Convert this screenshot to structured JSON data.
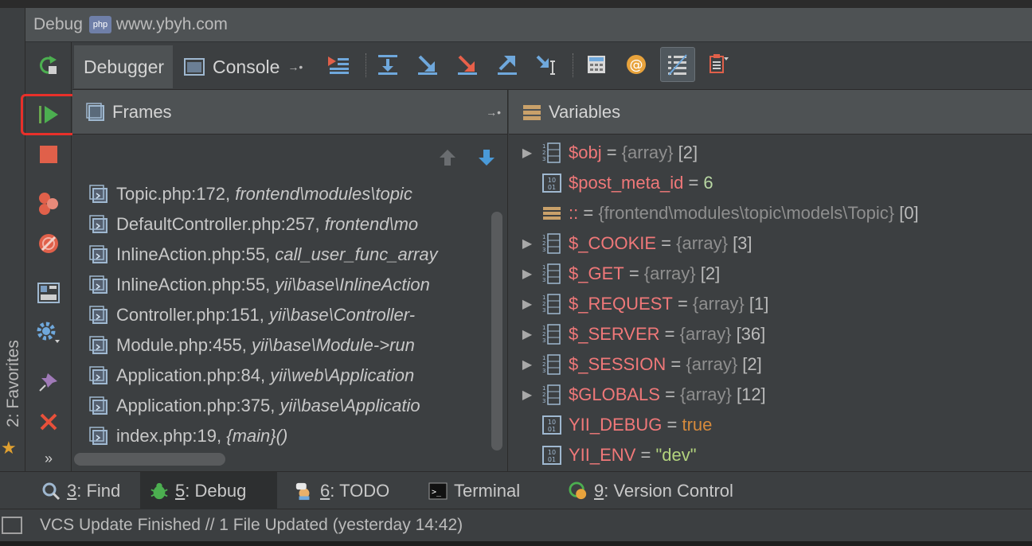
{
  "window": {
    "title_prefix": "Debug",
    "php_badge": "php",
    "title": "www.ybyh.com"
  },
  "sidebar": {
    "favorites_label": "2: Favorites"
  },
  "tabs": {
    "debugger": "Debugger",
    "console": "Console"
  },
  "frames": {
    "title": "Frames",
    "rows": [
      {
        "file": "Topic.php:172, ",
        "context": "frontend\\modules\\topic"
      },
      {
        "file": "DefaultController.php:257, ",
        "context": "frontend\\mo"
      },
      {
        "file": "InlineAction.php:55, ",
        "context": "call_user_func_array"
      },
      {
        "file": "InlineAction.php:55, ",
        "context": "yii\\base\\InlineAction"
      },
      {
        "file": "Controller.php:151, ",
        "context": "yii\\base\\Controller-"
      },
      {
        "file": "Module.php:455, ",
        "context": "yii\\base\\Module->run"
      },
      {
        "file": "Application.php:84, ",
        "context": "yii\\web\\Application"
      },
      {
        "file": "Application.php:375, ",
        "context": "yii\\base\\Applicatio"
      },
      {
        "file": "index.php:19, ",
        "context": "{main}()"
      }
    ]
  },
  "variables": {
    "title": "Variables",
    "rows": [
      {
        "name": "$obj",
        "eq": " = ",
        "type": "{array}",
        "count": " [2]"
      },
      {
        "name": "$post_meta_id",
        "eq": " = ",
        "value": "6"
      },
      {
        "name": "::",
        "eq": " = ",
        "type": "{frontend\\modules\\topic\\models\\Topic}",
        "count": " [0]"
      },
      {
        "name": "$_COOKIE",
        "eq": " = ",
        "type": "{array}",
        "count": " [3]"
      },
      {
        "name": "$_GET",
        "eq": " = ",
        "type": "{array}",
        "count": " [2]"
      },
      {
        "name": "$_REQUEST",
        "eq": " = ",
        "type": "{array}",
        "count": " [1]"
      },
      {
        "name": "$_SERVER",
        "eq": " = ",
        "type": "{array}",
        "count": " [36]"
      },
      {
        "name": "$_SESSION",
        "eq": " = ",
        "type": "{array}",
        "count": " [2]"
      },
      {
        "name": "$GLOBALS",
        "eq": " = ",
        "type": "{array}",
        "count": " [12]"
      },
      {
        "name": "YII_DEBUG",
        "eq": " = ",
        "value": "true"
      },
      {
        "name": "YII_ENV",
        "eq": " = ",
        "value": "\"dev\""
      }
    ]
  },
  "bottom_tabs": {
    "find_num": "3",
    "find_rest": ": Find",
    "debug_num": "5",
    "debug_rest": ": Debug",
    "todo_num": "6",
    "todo_rest": ": TODO",
    "terminal": "Terminal",
    "vcs_num": "9",
    "vcs_rest": ": Version Control"
  },
  "status": {
    "text": "VCS Update Finished // 1 File Updated (yesterday 14:42)"
  },
  "colors": {
    "background": "#3c3f41",
    "header": "#4e5254",
    "var_name": "#f07879",
    "highlight_box": "#e8302a"
  }
}
